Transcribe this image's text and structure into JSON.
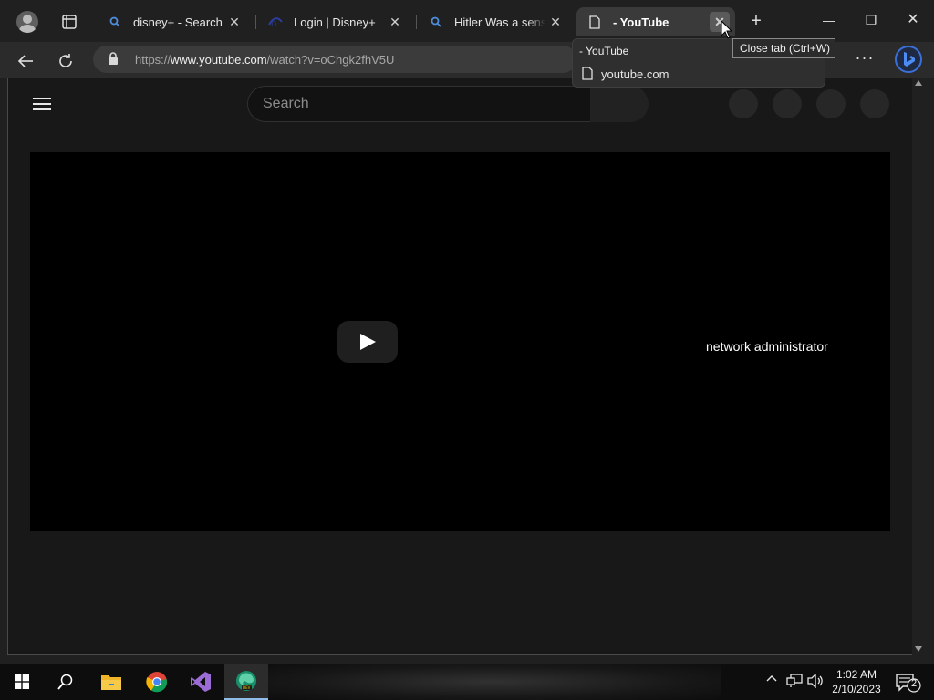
{
  "browser": {
    "tabs": [
      {
        "title": "disney+ - Search",
        "icon": "search-icon",
        "close": "✕"
      },
      {
        "title": "Login | Disney+",
        "icon": "disney-icon",
        "close": "✕"
      },
      {
        "title": "Hitler Was a sensei",
        "icon": "search-icon",
        "close": "✕"
      },
      {
        "title": "- YouTube",
        "icon": "page-icon",
        "close": "✕",
        "active": true
      }
    ],
    "new_tab": "+",
    "window": {
      "minimize": "—",
      "restore": "❐",
      "close": "✕"
    },
    "address": {
      "prefix": "https://",
      "host": "www.youtube.com",
      "path": "/watch?v=oChgk2fhV5U"
    },
    "menu": "···",
    "hover_card": {
      "title": "- YouTube",
      "domain": "youtube.com"
    },
    "tooltip": "Close tab (Ctrl+W)"
  },
  "youtube": {
    "search_placeholder": "Search",
    "video_overlay_text": "network administrator"
  },
  "taskbar": {
    "apps": [
      "start-icon",
      "search-icon",
      "file-explorer-icon",
      "chrome-icon",
      "visual-studio-icon",
      "edge-dev-icon"
    ],
    "clock_time": "1:02 AM",
    "clock_date": "2/10/2023",
    "notification_count": "2"
  },
  "colors": {
    "accent": "#8fbce6",
    "background": "#202020",
    "page": "#181818"
  }
}
